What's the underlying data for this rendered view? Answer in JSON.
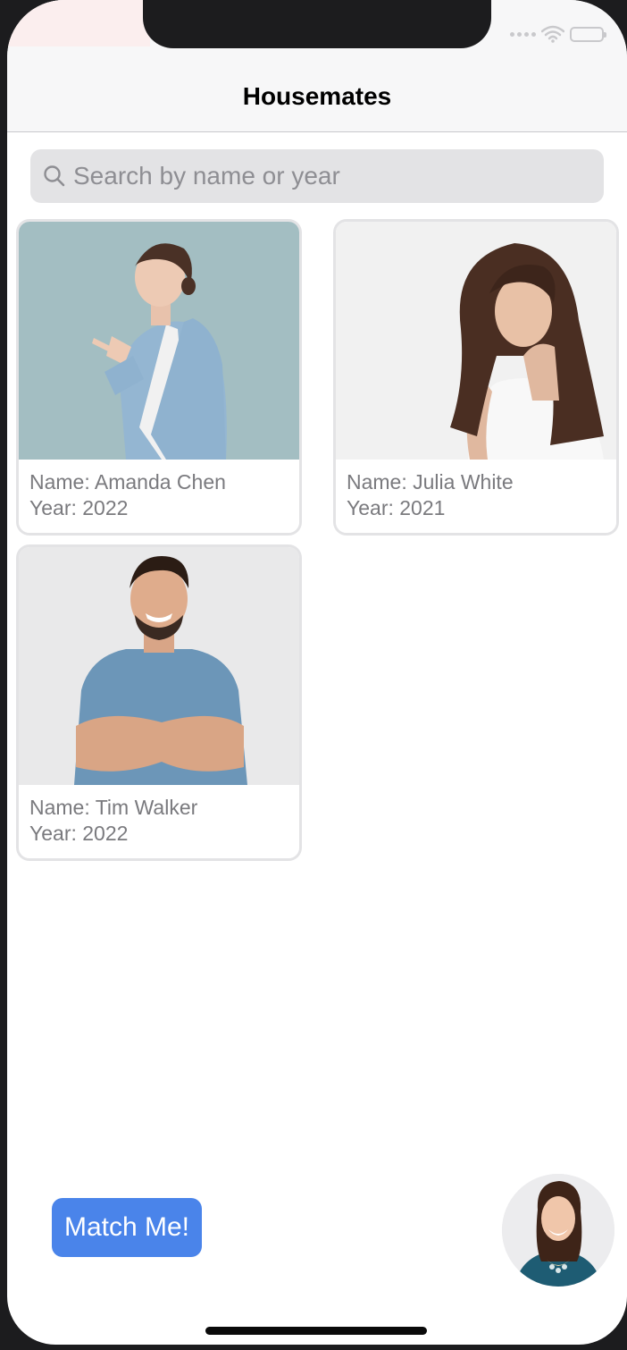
{
  "nav": {
    "title": "Housemates"
  },
  "search": {
    "placeholder": "Search by name or year",
    "value": ""
  },
  "housemates": [
    {
      "name": "Name: Amanda Chen",
      "year": "Year: 2022"
    },
    {
      "name": "Name: Julia White",
      "year": "Year: 2021"
    },
    {
      "name": "Name: Tim Walker",
      "year": "Year: 2022"
    }
  ],
  "actions": {
    "match_label": "Match Me!"
  },
  "colors": {
    "accent": "#4a84ea",
    "nav_background": "#f7f7f8",
    "search_background": "#e3e3e5",
    "card_text": "#7a7a7e"
  },
  "icons": {
    "search": "search-icon",
    "wifi": "wifi-icon",
    "battery": "battery-icon",
    "signal": "signal-icon"
  }
}
